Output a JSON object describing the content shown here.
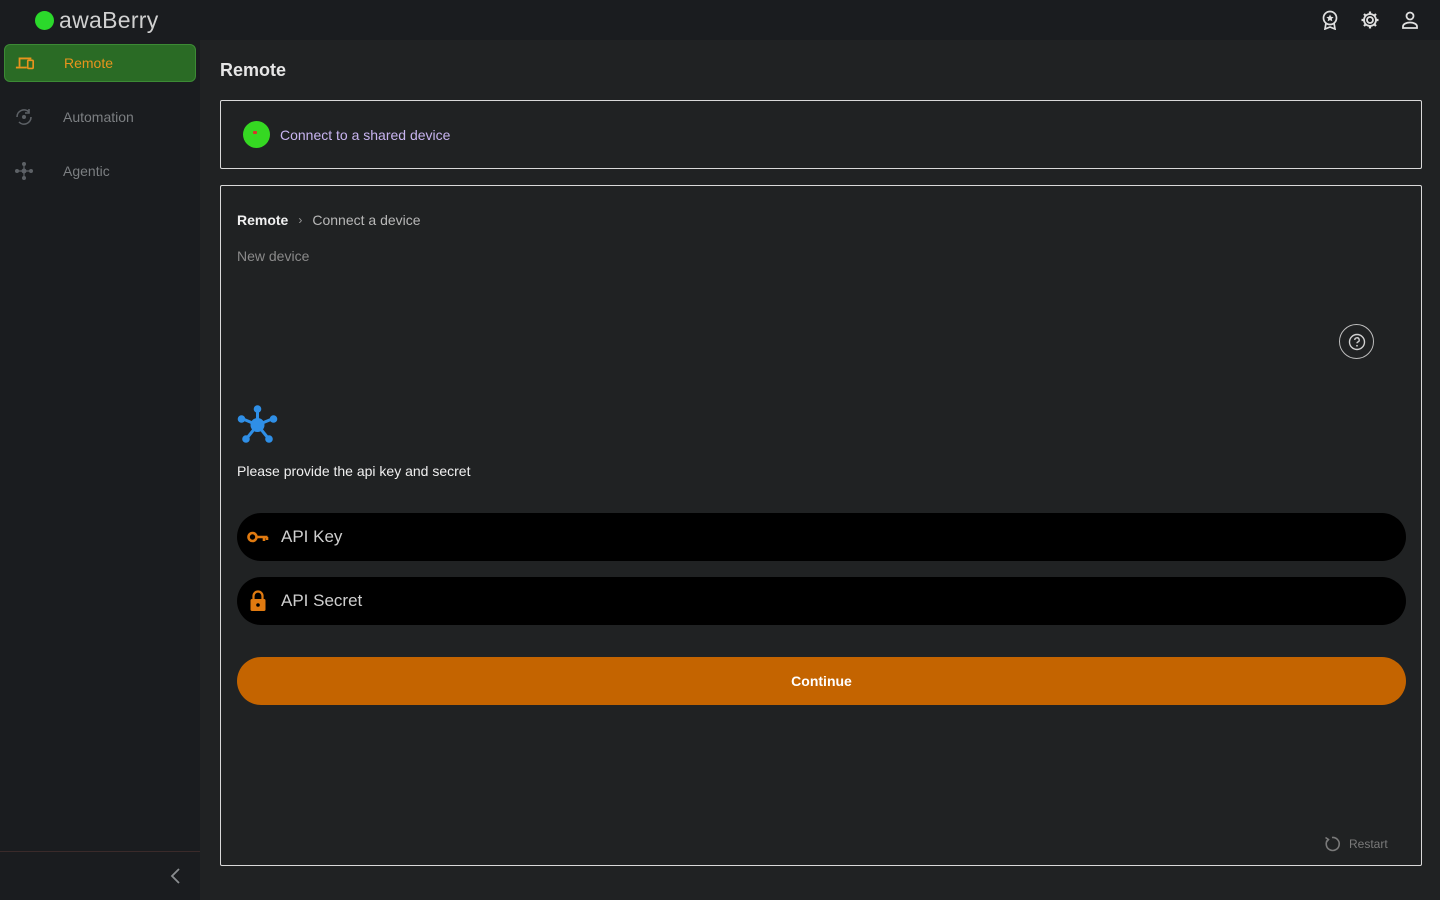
{
  "app": {
    "brand": "awaBerry"
  },
  "sidebar": {
    "items": [
      {
        "label": "Remote",
        "icon": "devices-icon",
        "active": true
      },
      {
        "label": "Automation",
        "icon": "automation-icon",
        "active": false
      },
      {
        "label": "Agentic",
        "icon": "agentic-icon",
        "active": false
      }
    ]
  },
  "topbar": {
    "icons": [
      "award-icon",
      "settings-icon",
      "account-icon"
    ]
  },
  "main": {
    "title": "Remote",
    "shared_device_link": "Connect to a shared device",
    "breadcrumb": {
      "root": "Remote",
      "current": "Connect a device"
    },
    "subtitle": "New device",
    "prompt": "Please provide the api key and secret",
    "api_key": {
      "placeholder": "API Key",
      "value": ""
    },
    "api_secret": {
      "placeholder": "API Secret",
      "value": ""
    },
    "continue_label": "Continue",
    "restart_label": "Restart"
  },
  "colors": {
    "accent_orange": "#c46400",
    "brand_green": "#2bd92b",
    "active_nav_bg": "#2a6b25",
    "link_purple": "#c8b4f0",
    "hub_blue": "#2f8fe6"
  }
}
